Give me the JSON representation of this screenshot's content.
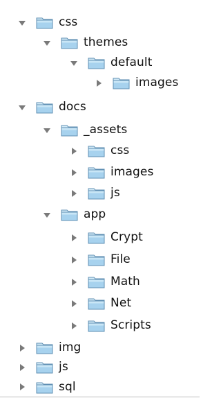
{
  "colors": {
    "triangle": "#7a7a7a",
    "folder_top": "#c9e6f6",
    "folder_body": "#a7d2ee",
    "folder_edge": "#5f8fb3",
    "folder_tab": "#d6edf9"
  },
  "icons": {
    "expanded": "disclosure-triangle-down-icon",
    "collapsed": "disclosure-triangle-right-icon",
    "folder": "folder-icon"
  },
  "tree": {
    "items": [
      {
        "label": "css",
        "expanded": true
      },
      {
        "label": "themes",
        "expanded": true
      },
      {
        "label": "default",
        "expanded": true
      },
      {
        "label": "images",
        "expanded": false
      },
      {
        "label": "docs",
        "expanded": true
      },
      {
        "label": "_assets",
        "expanded": true
      },
      {
        "label": "css",
        "expanded": false
      },
      {
        "label": "images",
        "expanded": false
      },
      {
        "label": "js",
        "expanded": false
      },
      {
        "label": "app",
        "expanded": true
      },
      {
        "label": "Crypt",
        "expanded": false
      },
      {
        "label": "File",
        "expanded": false
      },
      {
        "label": "Math",
        "expanded": false
      },
      {
        "label": "Net",
        "expanded": false
      },
      {
        "label": "Scripts",
        "expanded": false
      },
      {
        "label": "img",
        "expanded": false
      },
      {
        "label": "js",
        "expanded": false
      },
      {
        "label": "sql",
        "expanded": false
      }
    ]
  }
}
